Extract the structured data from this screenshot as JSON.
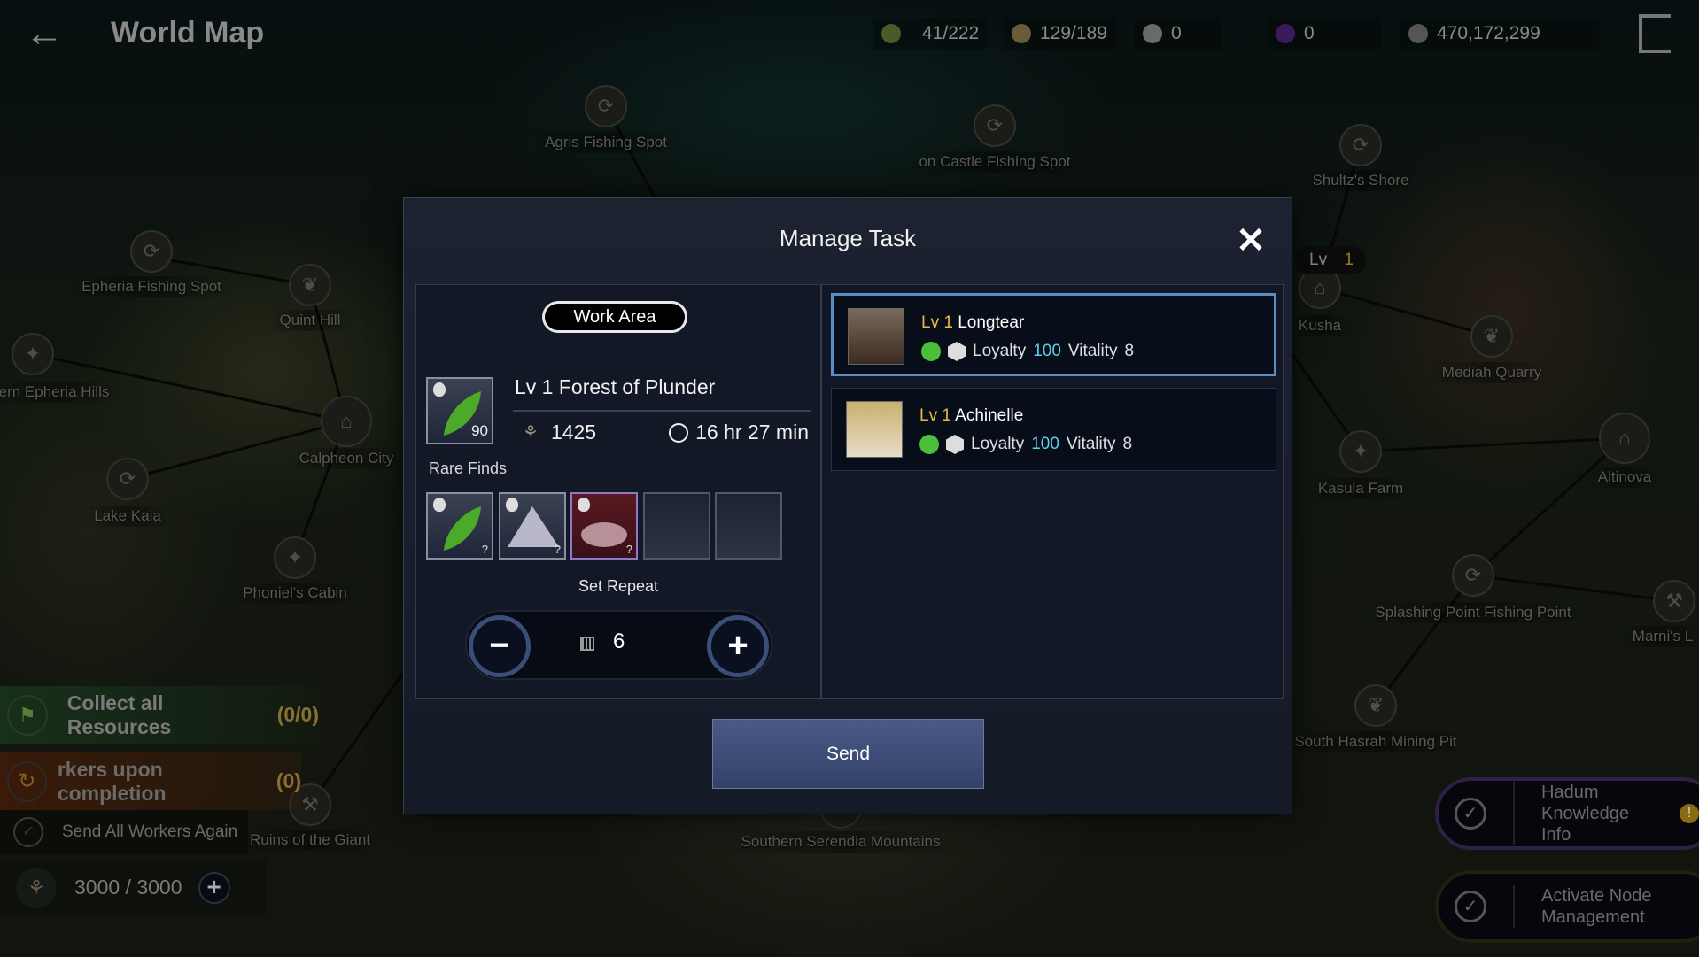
{
  "topbar": {
    "title": "World Map",
    "resources": [
      {
        "icon": "energy-icon",
        "value": "41/222"
      },
      {
        "icon": "contribution-icon",
        "value": "129/189"
      },
      {
        "icon": "pearl-icon",
        "value": "0"
      },
      {
        "icon": "crystal-icon",
        "value": "0"
      },
      {
        "icon": "silver-icon",
        "value": "470,172,299"
      }
    ]
  },
  "map": {
    "labels": [
      "Agris Fishing Spot",
      "on Castle Fishing Spot",
      "Shultz's Shore",
      "Epheria Fishing Spot",
      "Quint Hill",
      "Kusha",
      "Mediah Quarry",
      "ern Epheria Hills",
      "Calpheon City",
      "Lake Kaia",
      "Kasula Farm",
      "Altinova",
      "Phoniel's Cabin",
      "Splashing Point Fishing Point",
      "Marni's L",
      "South Hasrah Mining Pit",
      "Ruins of the Giant",
      "Southern Serendia Mountains"
    ],
    "lv_badge": {
      "label": "Lv",
      "value": "1"
    }
  },
  "dialog": {
    "title": "Manage Task",
    "work_area": "Work Area",
    "node": {
      "name": "Lv 1 Forest of Plunder",
      "item_count": "90",
      "workload": "1425",
      "time": "16 hr 27 min"
    },
    "rare_finds_label": "Rare Finds",
    "rare_finds": [
      {
        "item": "leaf",
        "qty": "?"
      },
      {
        "item": "silver-ore",
        "qty": "?"
      },
      {
        "item": "red-ore",
        "qty": "?"
      },
      {},
      {}
    ],
    "set_repeat_label": "Set Repeat",
    "repeat_count": "6",
    "send": "Send",
    "workers": [
      {
        "lv": "Lv 1",
        "name": "Longtear",
        "loyalty_label": "Loyalty",
        "loyalty": "100",
        "vitality_label": "Vitality",
        "vitality": "8",
        "selected": true
      },
      {
        "lv": "Lv 1",
        "name": "Achinelle",
        "loyalty_label": "Loyalty",
        "loyalty": "100",
        "vitality_label": "Vitality",
        "vitality": "8",
        "selected": false
      }
    ]
  },
  "left_actions": {
    "collect": "Collect all Resources",
    "collect_count": "(0/0)",
    "workers_completion": "rkers upon completion",
    "workers_count": "(0)",
    "send_again": "Send All Workers Again",
    "energy": "3000 / 3000"
  },
  "right_actions": {
    "hadum": "Hadum Knowledge Info",
    "activate": "Activate Node Management"
  },
  "colors": {
    "accent_gold": "#e8b840",
    "accent_cyan": "#5ad0e8",
    "selected_border": "#5a8ec0"
  }
}
